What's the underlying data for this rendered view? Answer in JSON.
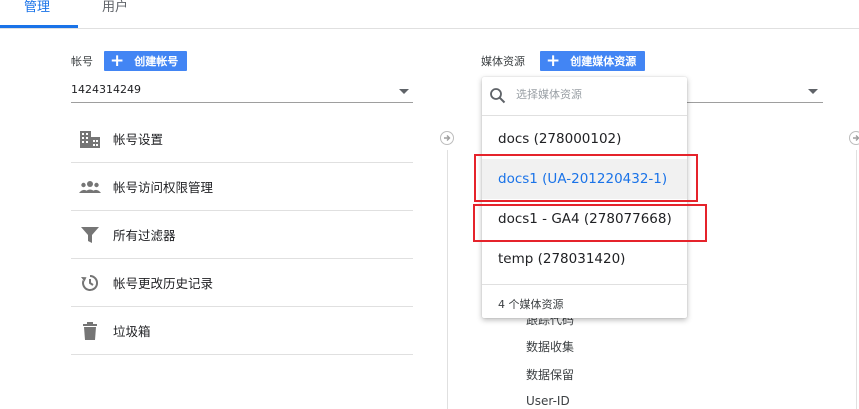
{
  "tabs": [
    {
      "label": "管理",
      "active": true
    },
    {
      "label": "用户",
      "active": false
    }
  ],
  "account_column": {
    "label": "帐号",
    "create_button": "创建帐号",
    "selected_account": "1424314249",
    "menu": [
      {
        "label": "帐号设置",
        "icon": "building-icon"
      },
      {
        "label": "帐号访问权限管理",
        "icon": "people-icon"
      },
      {
        "label": "所有过滤器",
        "icon": "filter-icon"
      },
      {
        "label": "帐号更改历史记录",
        "icon": "history-icon"
      },
      {
        "label": "垃圾箱",
        "icon": "trash-icon"
      }
    ]
  },
  "property_column": {
    "label": "媒体资源",
    "create_button": "创建媒体资源",
    "sub_items": [
      "跟踪代码",
      "数据收集",
      "数据保留",
      "User-ID"
    ]
  },
  "dropdown": {
    "search_placeholder": "选择媒体资源",
    "options": [
      {
        "label": "docs (278000102)",
        "selected": false
      },
      {
        "label": "docs1 (UA-201220432-1)",
        "selected": true
      },
      {
        "label": "docs1 - GA4 (278077668)",
        "selected": false
      },
      {
        "label": "temp (278031420)",
        "selected": false
      }
    ],
    "footer_count": "4 个媒体资源"
  },
  "colors": {
    "accent": "#1a73e8",
    "button": "#4285f4",
    "highlight": "#e5232b",
    "icon": "#757575"
  }
}
